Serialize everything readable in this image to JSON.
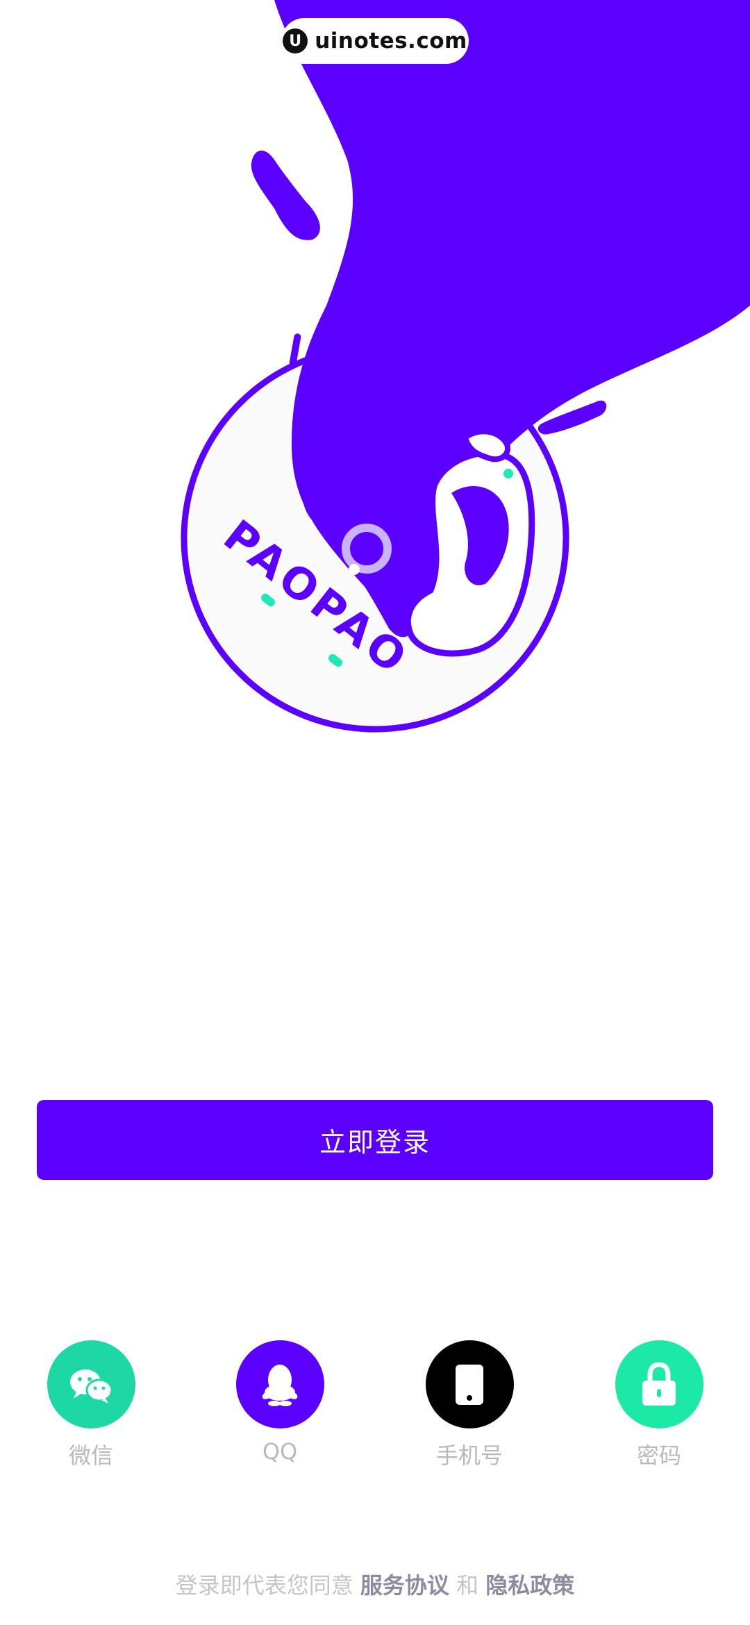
{
  "watermark": {
    "text": "uinotes.com"
  },
  "logo": {
    "wordmark": "PAOPAO",
    "accent_color": "#5b00ff",
    "highlight_color": "#1de9b6"
  },
  "login": {
    "button_label": "立即登录"
  },
  "methods": [
    {
      "label": "微信",
      "icon": "wechat-icon",
      "color": "#1dd8a4"
    },
    {
      "label": "QQ",
      "icon": "qq-penguin-icon",
      "color": "#5b00ff"
    },
    {
      "label": "手机号",
      "icon": "phone-icon",
      "color": "#000000"
    },
    {
      "label": "密码",
      "icon": "lock-icon",
      "color": "#1de9a6"
    }
  ],
  "agreement": {
    "prefix": "登录即代表您同意",
    "service_link": "服务协议",
    "conjunction": "和",
    "privacy_link": "隐私政策"
  }
}
